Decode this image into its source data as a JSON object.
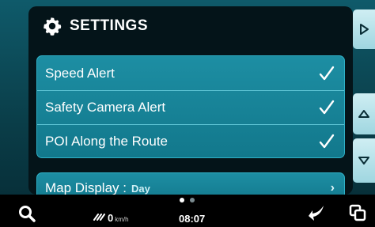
{
  "panel": {
    "title": "SETTINGS",
    "icon": "gear-icon"
  },
  "settings": [
    {
      "label": "Speed Alert",
      "checked": true
    },
    {
      "label": "Safety Camera Alert",
      "checked": true
    },
    {
      "label": "POI Along the Route",
      "checked": true
    }
  ],
  "map_display": {
    "label": "Map Display :",
    "value": "Day"
  },
  "status": {
    "speed": "0",
    "speed_unit": "km/h",
    "time": "08:07"
  },
  "pager": {
    "pages": 2,
    "current": 1
  },
  "colors": {
    "accent": "#1d8ea3",
    "panel_bg": "#041419",
    "side_button": "#cfeef3"
  }
}
